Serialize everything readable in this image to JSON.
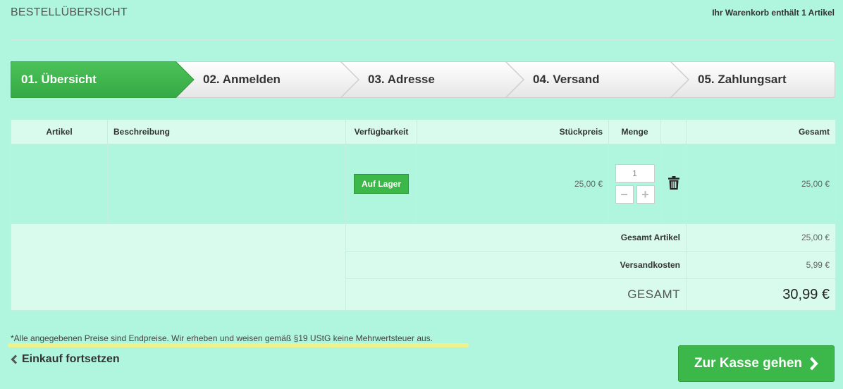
{
  "header": {
    "title": "BESTELLÜBERSICHT",
    "cart_count": "Ihr Warenkorb enthält 1 Artikel"
  },
  "steps": [
    {
      "label": "01. Übersicht",
      "active": true
    },
    {
      "label": "02. Anmelden",
      "active": false
    },
    {
      "label": "03. Adresse",
      "active": false
    },
    {
      "label": "04. Versand",
      "active": false
    },
    {
      "label": "05. Zahlungsart",
      "active": false
    }
  ],
  "table": {
    "headers": {
      "artikel": "Artikel",
      "beschreibung": "Beschreibung",
      "verfuegbarkeit": "Verfügbarkeit",
      "stueckpreis": "Stückpreis",
      "menge": "Menge",
      "gesamt": "Gesamt"
    },
    "item": {
      "availability": "Auf Lager",
      "unit_price": "25,00 €",
      "quantity": "1",
      "minus": "−",
      "plus": "+",
      "total": "25,00 €"
    },
    "summary": {
      "items_label": "Gesamt Artikel",
      "items_value": "25,00 €",
      "shipping_label": "Versandkosten",
      "shipping_value": "5,99 €",
      "total_label": "GESAMT",
      "total_value": "30,99 €"
    }
  },
  "footer": {
    "disclaimer": "*Alle angegebenen Preise sind Endpreise. Wir erheben und weisen gemäß §19 UStG keine Mehrwertsteuer aus.",
    "continue_label": "Einkauf fortsetzen",
    "checkout_label": "Zur Kasse gehen"
  },
  "colors": {
    "background": "#b0f5dd",
    "accent_green": "#3cb84a",
    "table_header": "#d8fbee"
  },
  "icons": [
    "trash-icon",
    "chevron-left-icon",
    "chevron-right-icon"
  ]
}
